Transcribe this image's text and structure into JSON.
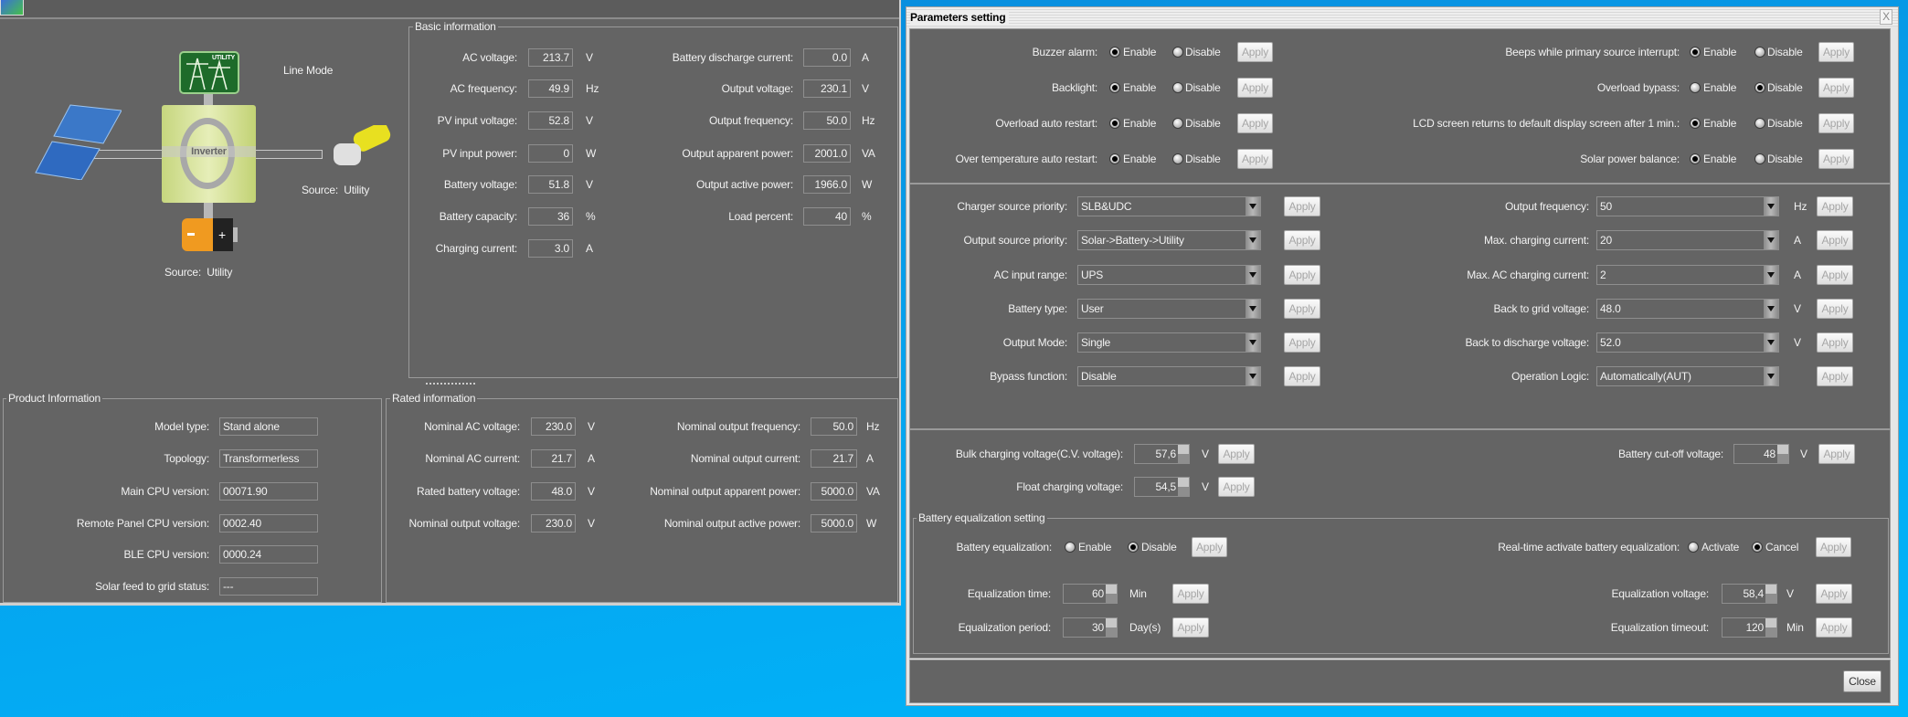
{
  "main_window": {
    "diagram": {
      "mode": "Line Mode",
      "inverter_label": "Inverter",
      "utility_label": "UTILITY",
      "load_source": "Source:  Utility",
      "battery_source": "Source:  Utility"
    },
    "basic_info": {
      "title": "Basic information",
      "left": [
        {
          "label": "AC voltage:",
          "value": "213.7",
          "unit": "V"
        },
        {
          "label": "AC frequency:",
          "value": "49.9",
          "unit": "Hz"
        },
        {
          "label": "PV input voltage:",
          "value": "52.8",
          "unit": "V"
        },
        {
          "label": "PV input power:",
          "value": "0",
          "unit": "W"
        },
        {
          "label": "Battery voltage:",
          "value": "51.8",
          "unit": "V"
        },
        {
          "label": "Battery capacity:",
          "value": "36",
          "unit": "%"
        },
        {
          "label": "Charging current:",
          "value": "3.0",
          "unit": "A"
        }
      ],
      "right": [
        {
          "label": "Battery discharge current:",
          "value": "0.0",
          "unit": "A"
        },
        {
          "label": "Output voltage:",
          "value": "230.1",
          "unit": "V"
        },
        {
          "label": "Output frequency:",
          "value": "50.0",
          "unit": "Hz"
        },
        {
          "label": "Output apparent power:",
          "value": "2001.0",
          "unit": "VA"
        },
        {
          "label": "Output active power:",
          "value": "1966.0",
          "unit": "W"
        },
        {
          "label": "Load percent:",
          "value": "40",
          "unit": "%"
        }
      ]
    },
    "product_info": {
      "title": "Product Information",
      "rows": [
        {
          "label": "Model type:",
          "value": "Stand alone"
        },
        {
          "label": "Topology:",
          "value": "Transformerless"
        },
        {
          "label": "Main CPU version:",
          "value": "00071.90"
        },
        {
          "label": "Remote Panel CPU version:",
          "value": "0002.40"
        },
        {
          "label": "BLE CPU version:",
          "value": "0000.24"
        },
        {
          "label": "Solar feed to grid status:",
          "value": "---"
        }
      ]
    },
    "rated_info": {
      "title": "Rated information",
      "left": [
        {
          "label": "Nominal AC voltage:",
          "value": "230.0",
          "unit": "V"
        },
        {
          "label": "Nominal AC current:",
          "value": "21.7",
          "unit": "A"
        },
        {
          "label": "Rated battery voltage:",
          "value": "48.0",
          "unit": "V"
        },
        {
          "label": "Nominal output voltage:",
          "value": "230.0",
          "unit": "V"
        }
      ],
      "right": [
        {
          "label": "Nominal output frequency:",
          "value": "50.0",
          "unit": "Hz"
        },
        {
          "label": "Nominal output current:",
          "value": "21.7",
          "unit": "A"
        },
        {
          "label": "Nominal output apparent power:",
          "value": "5000.0",
          "unit": "VA"
        },
        {
          "label": "Nominal output active power:",
          "value": "5000.0",
          "unit": "W"
        }
      ]
    }
  },
  "dialog": {
    "title": "Parameters setting",
    "close_x": "X",
    "close_label": "Close",
    "apply_label": "Apply",
    "toggles": {
      "left": [
        {
          "label": "Buzzer alarm:",
          "options": [
            "Enable",
            "Disable"
          ],
          "selected": 0
        },
        {
          "label": "Backlight:",
          "options": [
            "Enable",
            "Disable"
          ],
          "selected": 0
        },
        {
          "label": "Overload auto restart:",
          "options": [
            "Enable",
            "Disable"
          ],
          "selected": 0
        },
        {
          "label": "Over temperature auto restart:",
          "options": [
            "Enable",
            "Disable"
          ],
          "selected": 0
        }
      ],
      "right": [
        {
          "label": "Beeps while primary source interrupt:",
          "options": [
            "Enable",
            "Disable"
          ],
          "selected": 0
        },
        {
          "label": "Overload bypass:",
          "options": [
            "Enable",
            "Disable"
          ],
          "selected": 1
        },
        {
          "label": "LCD screen returns to default display screen after 1 min.:",
          "options": [
            "Enable",
            "Disable"
          ],
          "selected": 0
        },
        {
          "label": "Solar power balance:",
          "options": [
            "Enable",
            "Disable"
          ],
          "selected": 0
        }
      ]
    },
    "selects": {
      "left": [
        {
          "label": "Charger source priority:",
          "value": "SLB&UDC",
          "unit": ""
        },
        {
          "label": "Output source priority:",
          "value": "Solar->Battery->Utility",
          "unit": ""
        },
        {
          "label": "AC input range:",
          "value": "UPS",
          "unit": ""
        },
        {
          "label": "Battery type:",
          "value": "User",
          "unit": ""
        },
        {
          "label": "Output Mode:",
          "value": "Single",
          "unit": ""
        },
        {
          "label": "Bypass function:",
          "value": "Disable",
          "unit": ""
        }
      ],
      "right": [
        {
          "label": "Output frequency:",
          "value": "50",
          "unit": "Hz"
        },
        {
          "label": "Max. charging current:",
          "value": "20",
          "unit": "A"
        },
        {
          "label": "Max. AC charging current:",
          "value": "2",
          "unit": "A"
        },
        {
          "label": "Back to grid voltage:",
          "value": "48.0",
          "unit": "V"
        },
        {
          "label": "Back to discharge voltage:",
          "value": "52.0",
          "unit": "V"
        },
        {
          "label": "Operation Logic:",
          "value": "Automatically(AUT)",
          "unit": ""
        }
      ]
    },
    "voltages": {
      "left": [
        {
          "label": "Bulk charging voltage(C.V. voltage):",
          "value": "57,6",
          "unit": "V"
        },
        {
          "label": "Float charging voltage:",
          "value": "54,5",
          "unit": "V"
        }
      ],
      "right": [
        {
          "label": "Battery cut-off voltage:",
          "value": "48",
          "unit": "V"
        }
      ]
    },
    "equalization": {
      "title": "Battery equalization setting",
      "toggle_left": {
        "label": "Battery equalization:",
        "options": [
          "Enable",
          "Disable"
        ],
        "selected": 1
      },
      "toggle_right": {
        "label": "Real-time activate battery equalization:",
        "options": [
          "Activate",
          "Cancel"
        ],
        "selected": 1
      },
      "left": [
        {
          "label": "Equalization time:",
          "value": "60",
          "unit": "Min"
        },
        {
          "label": "Equalization period:",
          "value": "30",
          "unit": "Day(s)"
        }
      ],
      "right": [
        {
          "label": "Equalization voltage:",
          "value": "58,4",
          "unit": "V"
        },
        {
          "label": "Equalization timeout:",
          "value": "120",
          "unit": "Min"
        }
      ]
    }
  },
  "colors": {
    "panel": "#646464",
    "desktop": "#05a6f0",
    "text": "#f2f2f2"
  }
}
